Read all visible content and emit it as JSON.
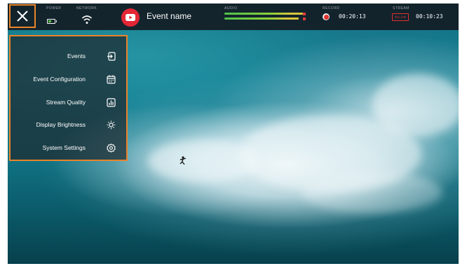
{
  "top_bar": {
    "power_label": "POWER",
    "network_label": "NETWORK",
    "event_name": "Event name",
    "audio_label": "AUDIO",
    "record_label": "RECORD",
    "record_time": "00:20:13",
    "stream_label": "STREAM",
    "stream_badge": "ON AIR",
    "stream_time": "00:10:23",
    "battery_level": 0.55,
    "audio_levels": [
      0.93,
      0.88
    ],
    "icons": {
      "close": "close-icon",
      "battery": "battery-icon",
      "network": "wifi-icon",
      "channel": "youtube-icon",
      "record": "record-icon"
    }
  },
  "menu": {
    "items": [
      {
        "label": "Events",
        "icon": "enter-icon"
      },
      {
        "label": "Event Configuration",
        "icon": "calendar-icon"
      },
      {
        "label": "Stream Quality",
        "icon": "bar-chart-icon"
      },
      {
        "label": "Display Brightness",
        "icon": "sun-icon"
      },
      {
        "label": "System Settings",
        "icon": "gear-icon"
      }
    ]
  },
  "colors": {
    "accent": "#e8842a",
    "record_red": "#e0302f",
    "youtube_red": "#e32636",
    "battery_green": "#5ec24a"
  }
}
